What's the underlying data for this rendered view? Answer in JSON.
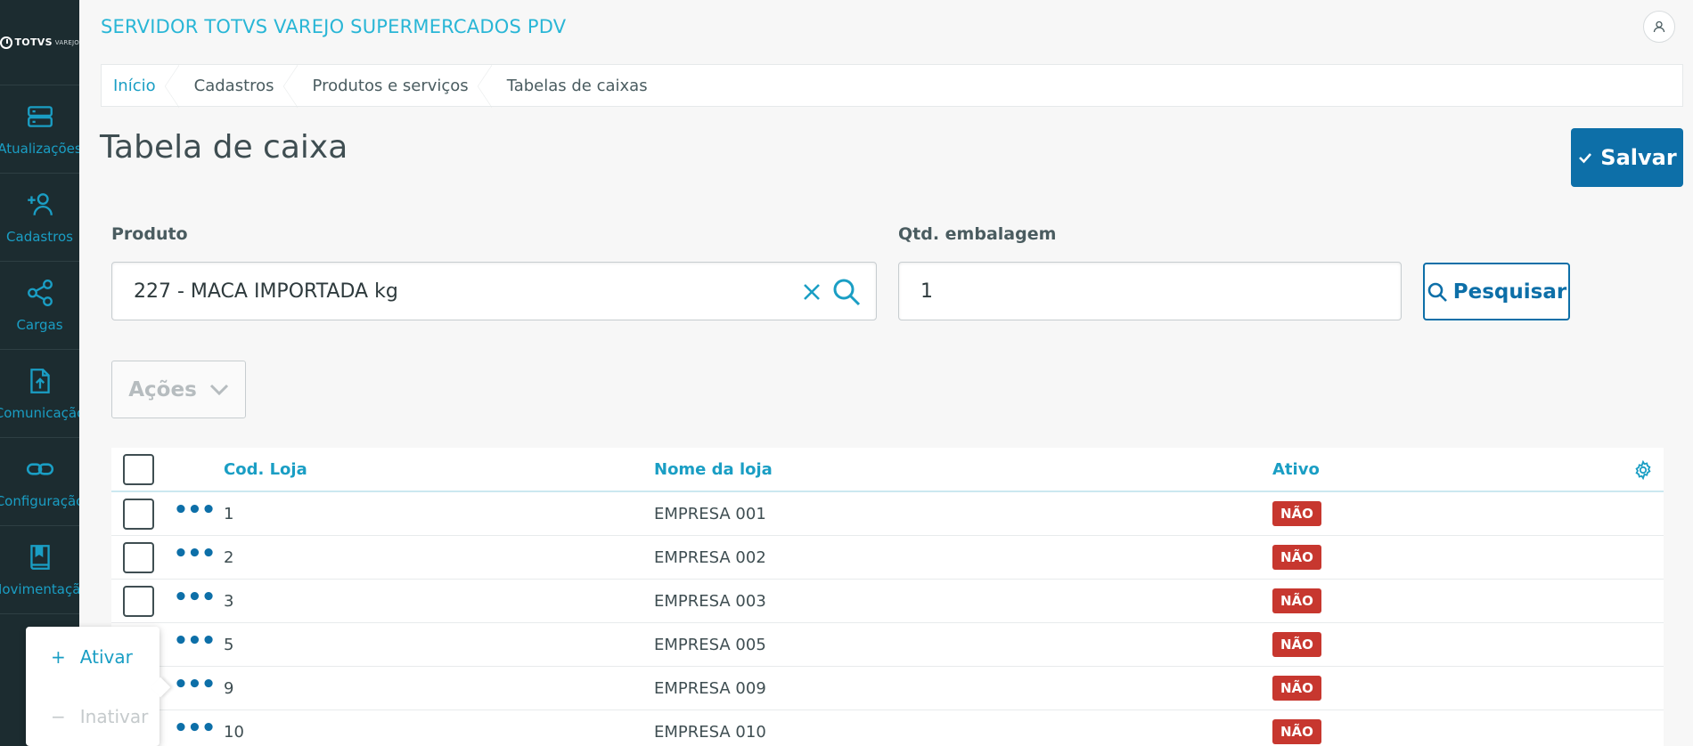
{
  "sidebar": {
    "logo_text": "TOTVS",
    "logo_sub": "VAREJO",
    "items": [
      {
        "label": "Atualizações",
        "icon": "server-icon"
      },
      {
        "label": "Cadastros",
        "icon": "add-user-icon"
      },
      {
        "label": "Cargas",
        "icon": "share-icon"
      },
      {
        "label": "Comunicação",
        "icon": "file-upload-icon"
      },
      {
        "label": "Configuração",
        "icon": "link-icon"
      },
      {
        "label": "Movimentação",
        "icon": "book-icon"
      }
    ]
  },
  "header": {
    "title": "SERVIDOR TOTVS VAREJO SUPERMERCADOS PDV"
  },
  "breadcrumb": [
    "Início",
    "Cadastros",
    "Produtos e serviços",
    "Tabelas de caixas"
  ],
  "page": {
    "title": "Tabela de caixa",
    "save_label": "Salvar"
  },
  "form": {
    "produto_label": "Produto",
    "produto_value": "227 - MACA IMPORTADA kg",
    "qtd_label": "Qtd. embalagem",
    "qtd_value": "1",
    "search_label": "Pesquisar"
  },
  "actions": {
    "label": "Ações"
  },
  "table": {
    "headers": {
      "cod": "Cod. Loja",
      "nome": "Nome da loja",
      "ativo": "Ativo"
    },
    "rows": [
      {
        "cod": "1",
        "nome": "EMPRESA 001",
        "ativo": "NÃO"
      },
      {
        "cod": "2",
        "nome": "EMPRESA 002",
        "ativo": "NÃO"
      },
      {
        "cod": "3",
        "nome": "EMPRESA 003",
        "ativo": "NÃO"
      },
      {
        "cod": "5",
        "nome": "EMPRESA 005",
        "ativo": "NÃO"
      },
      {
        "cod": "9",
        "nome": "EMPRESA 009",
        "ativo": "NÃO"
      },
      {
        "cod": "10",
        "nome": "EMPRESA 010",
        "ativo": "NÃO"
      }
    ]
  },
  "popup": {
    "ativar": {
      "symbol": "+",
      "label": "Ativar"
    },
    "inativar": {
      "symbol": "−",
      "label": "Inativar"
    }
  },
  "colors": {
    "accent": "#1a9ec4",
    "primary": "#0d6fa8",
    "sidebar": "#1c2c30",
    "badge": "#c7372f"
  }
}
